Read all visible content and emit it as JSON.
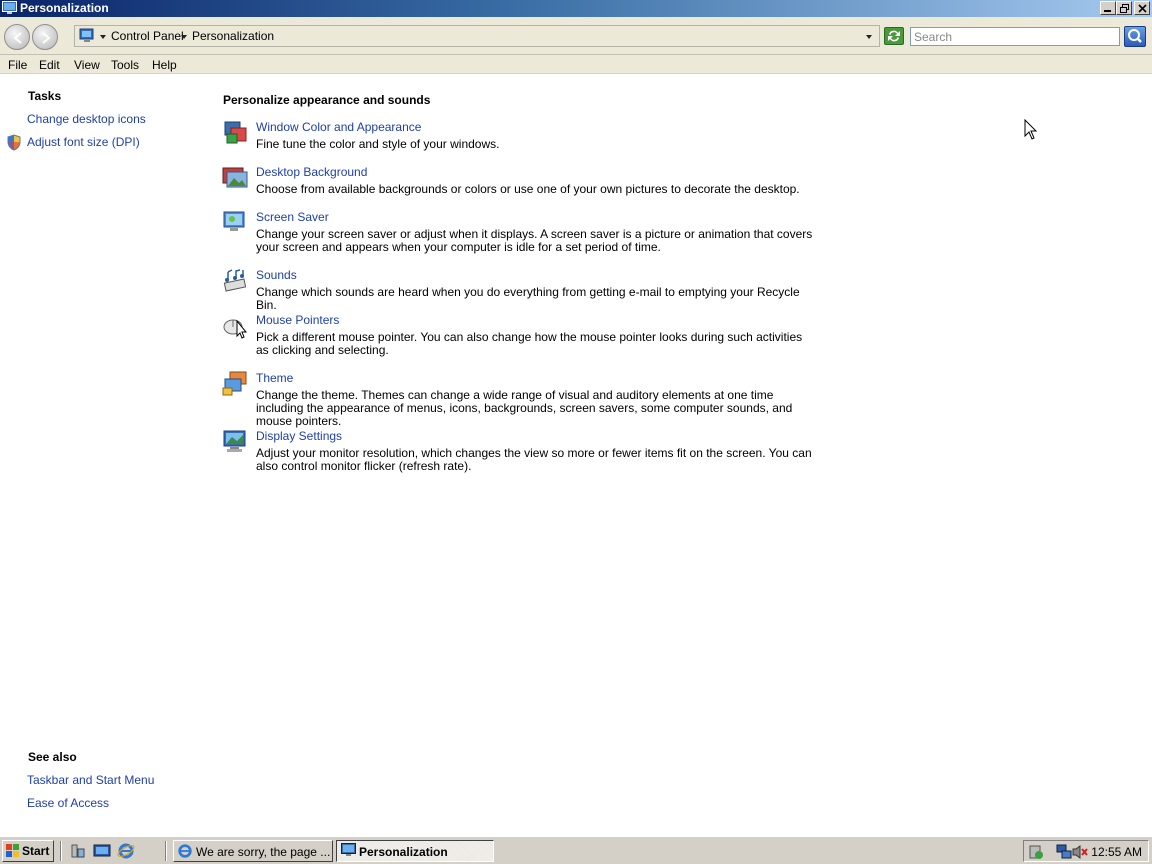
{
  "window": {
    "title": "Personalization"
  },
  "address": {
    "crumbs": [
      "Control Panel",
      "Personalization"
    ],
    "search_placeholder": "Search"
  },
  "menu": [
    "File",
    "Edit",
    "View",
    "Tools",
    "Help"
  ],
  "left": {
    "tasks_heading": "Tasks",
    "tasks": [
      "Change desktop icons",
      "Adjust font size (DPI)"
    ],
    "see_also_heading": "See also",
    "see_also": [
      "Taskbar and Start Menu",
      "Ease of Access"
    ]
  },
  "main": {
    "title": "Personalize appearance and sounds",
    "items": [
      {
        "title": "Window Color and Appearance",
        "desc": "Fine tune the color and style of your windows.",
        "icon": "window-color-icon"
      },
      {
        "title": "Desktop Background",
        "desc": "Choose from available backgrounds or colors or use one of your own pictures to decorate the desktop.",
        "icon": "desktop-background-icon"
      },
      {
        "title": "Screen Saver",
        "desc": "Change your screen saver or adjust when it displays. A screen saver is a picture or animation that covers your screen and appears when your computer is idle for a set period of time.",
        "icon": "screen-saver-icon"
      },
      {
        "title": "Sounds",
        "desc": "Change which sounds are heard when you do everything from getting e-mail to emptying your Recycle Bin.",
        "icon": "sounds-icon"
      },
      {
        "title": "Mouse Pointers",
        "desc": "Pick a different mouse pointer. You can also change how the mouse pointer looks during such activities as clicking and selecting.",
        "icon": "mouse-pointers-icon"
      },
      {
        "title": "Theme",
        "desc": "Change the theme. Themes can change a wide range of visual and auditory elements at one time including the appearance of menus, icons, backgrounds, screen savers, some computer sounds, and mouse pointers.",
        "icon": "theme-icon"
      },
      {
        "title": "Display Settings",
        "desc": "Adjust your monitor resolution, which changes the view so more or fewer items fit on the screen. You can also control monitor flicker (refresh rate).",
        "icon": "display-settings-icon"
      }
    ]
  },
  "taskbar": {
    "start_label": "Start",
    "tasks": [
      "We are sorry, the page ...",
      "Personalization"
    ],
    "clock": "12:55 AM"
  }
}
